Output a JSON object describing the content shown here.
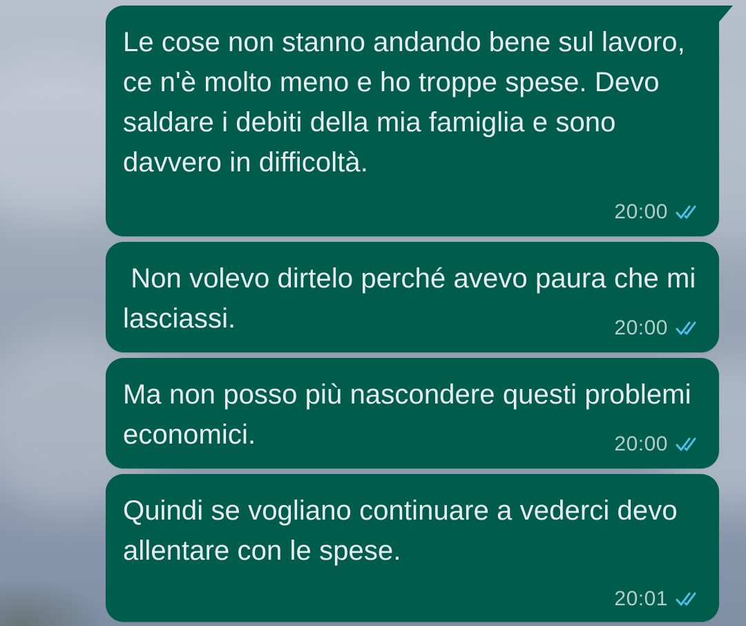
{
  "messages": [
    {
      "text": "Le cose non stanno andando bene sul lavoro, ce n'è molto meno e ho troppe spese. Devo saldare i debiti della mia famiglia e sono davvero in difficoltà.",
      "time": "20:00",
      "status_icon": "double-check-read-icon"
    },
    {
      "text": " Non volevo dirtelo perché avevo paura che mi lasciassi.",
      "time": "20:00",
      "status_icon": "double-check-read-icon"
    },
    {
      "text": "Ma non posso più nascondere questi problemi economici.",
      "time": "20:00",
      "status_icon": "double-check-read-icon"
    },
    {
      "text": "Quindi se vogliano continuare a vederci devo allentare con le spese.",
      "time": "20:01",
      "status_icon": "double-check-read-icon"
    }
  ],
  "colors": {
    "outgoing_bubble": "#005c4b",
    "message_text": "#e9edef",
    "timestamp": "#b4cec7",
    "read_ticks": "#53bdeb"
  }
}
